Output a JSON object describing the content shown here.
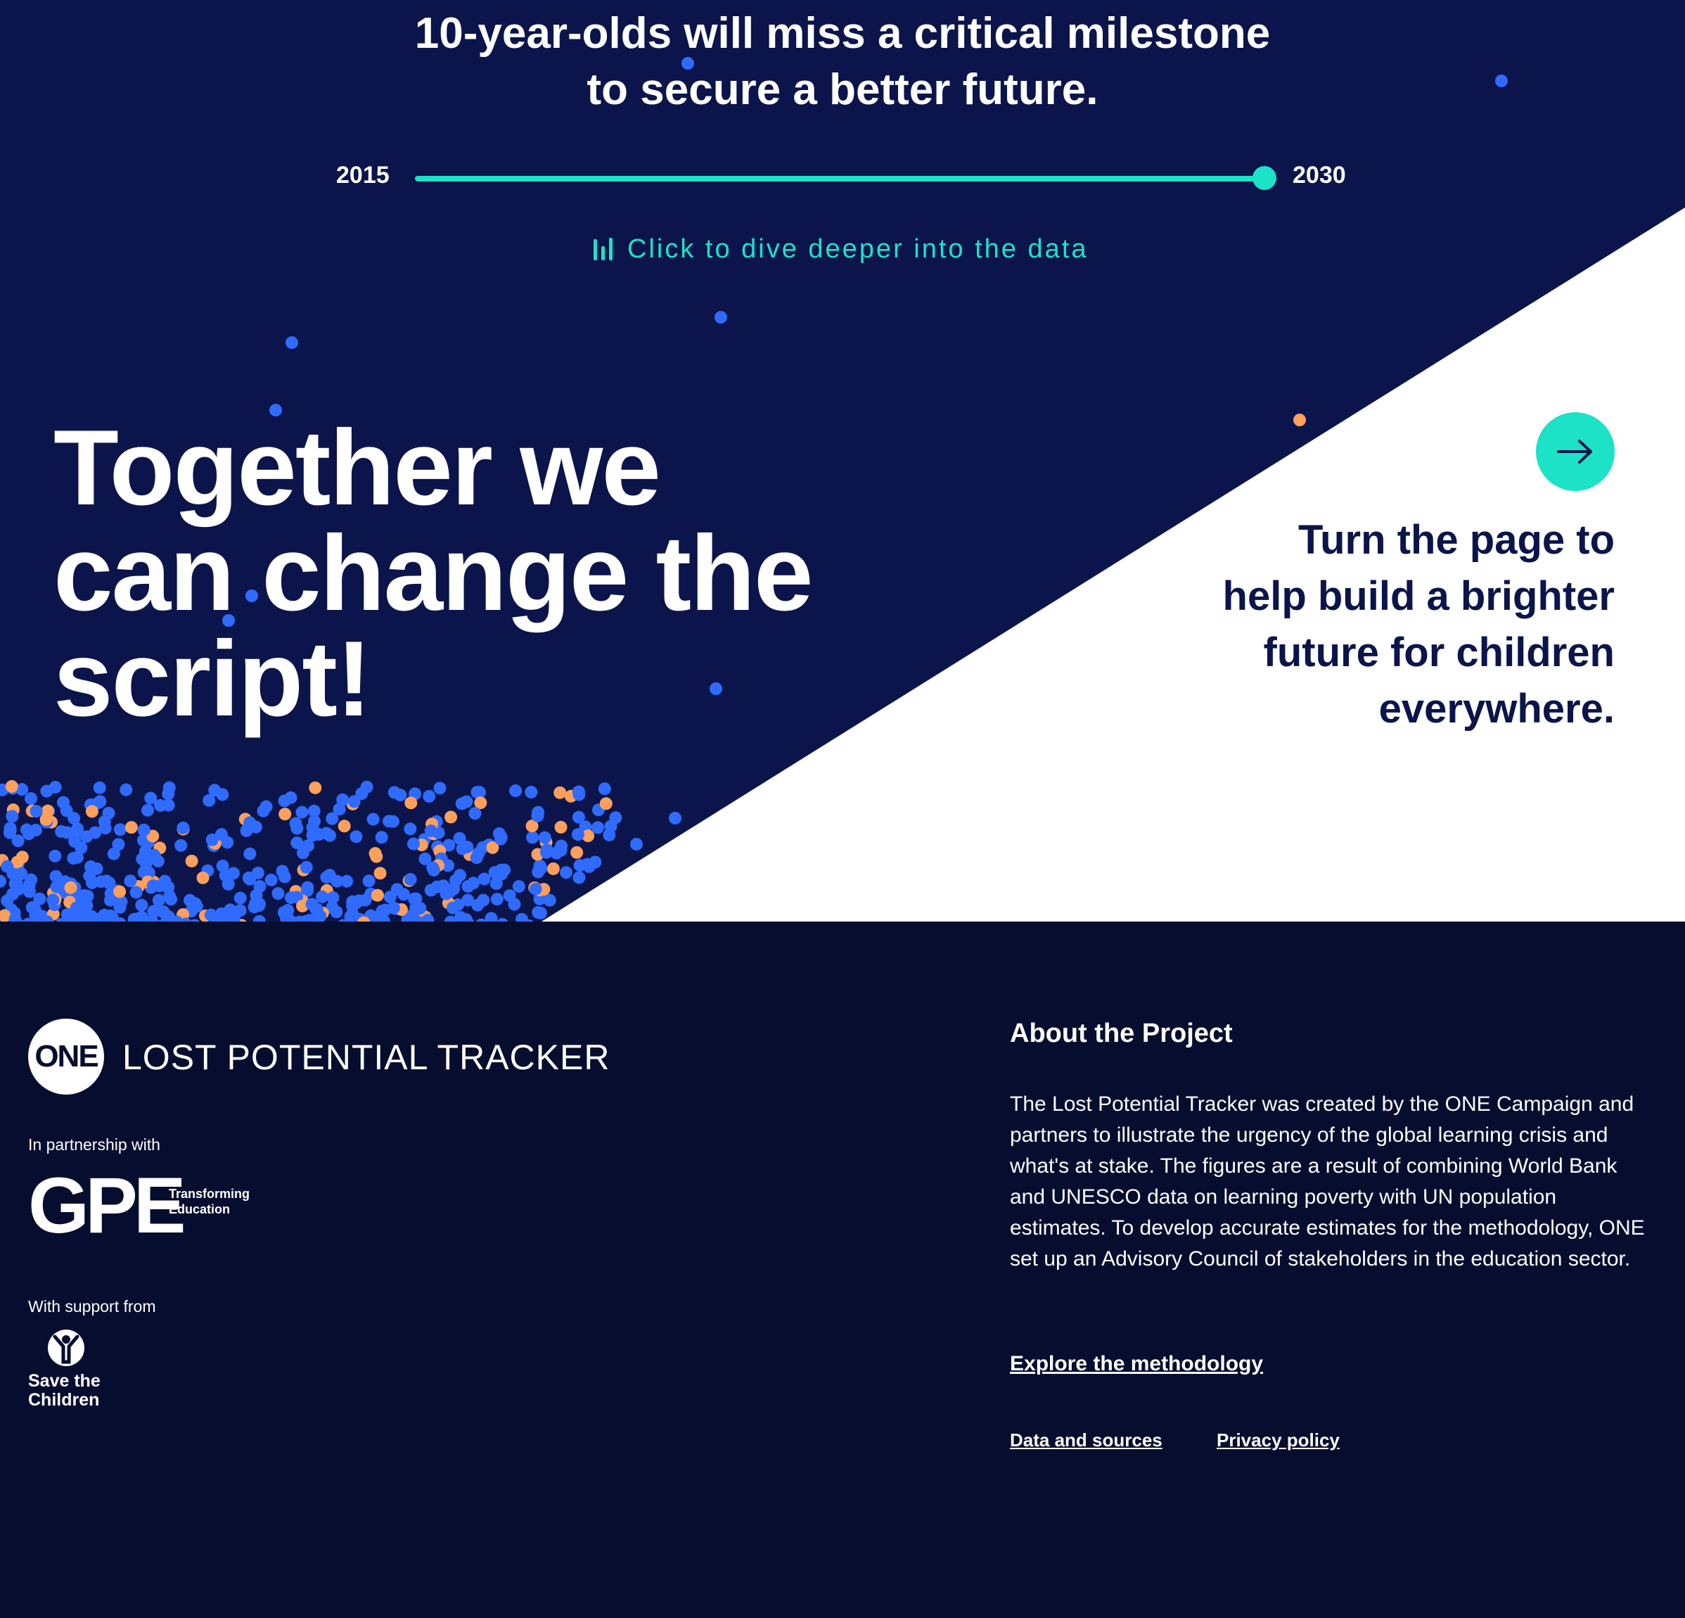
{
  "hero": {
    "headline_line1": "10-year-olds will miss a critical milestone",
    "headline_line2": "to secure a better future.",
    "timeline": {
      "start_year": "2015",
      "end_year": "2030",
      "selected_year": "2030"
    },
    "dive_link_label": "Click to dive deeper into the data",
    "slogan_line1": "Together we",
    "slogan_line2": "can change the",
    "slogan_line3": "script!",
    "cta_line1": "Turn the page to",
    "cta_line2": "help build a brighter",
    "cta_line3": "future for children",
    "cta_line4": "everywhere."
  },
  "footer": {
    "logo_text": "ONE",
    "site_name": "LOST POTENTIAL TRACKER",
    "partnership_label": "In partnership with",
    "partner_logo_text": "GPE",
    "partner_tagline_line1": "Transforming",
    "partner_tagline_line2": "Education",
    "support_label": "With support from",
    "supporter_line1": "Save the",
    "supporter_line2": "Children",
    "about_title": "About the Project",
    "about_body": "The Lost Potential Tracker was created by the ONE Campaign and partners to illustrate the urgency of the global learning crisis and what's at stake. The figures are a result of combining World Bank and UNESCO data on learning poverty with UN population estimates. To develop accurate estimates for the methodology, ONE set up an Advisory Council of stakeholders in the education sector.",
    "explore_link": "Explore the methodology",
    "data_link": "Data and sources",
    "privacy_link": "Privacy policy"
  },
  "colors": {
    "hero_background": "#0b154b",
    "footer_background": "#070d2e",
    "accent_teal": "#1ce2c7",
    "dot_blue": "#2f6bff",
    "dot_orange": "#ff9f5c",
    "text_white": "#ffffff"
  },
  "icons": {
    "chart": "bar-chart-icon",
    "arrow": "arrow-right-icon",
    "logo": "one-logo",
    "partner": "gpe-logo",
    "supporter": "save-the-children-logo"
  }
}
